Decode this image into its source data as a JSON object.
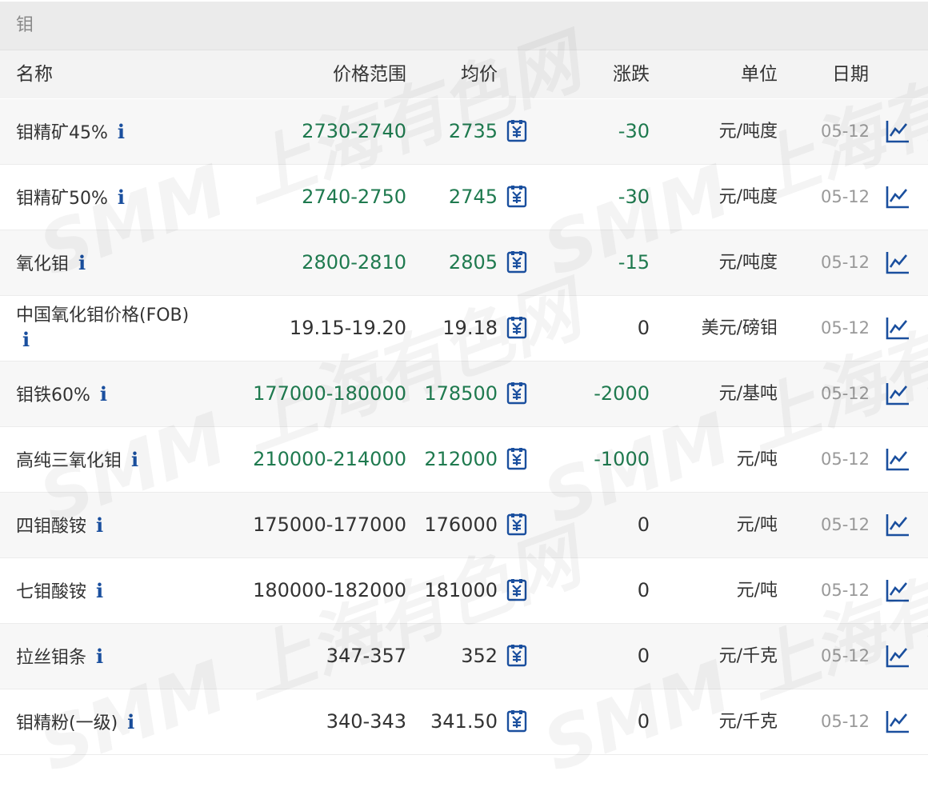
{
  "title": "钼",
  "columns": {
    "name": "名称",
    "range": "价格范围",
    "avg": "均价",
    "change": "涨跌",
    "unit": "单位",
    "date": "日期"
  },
  "info_glyph": "i",
  "watermark": "SMM 上海有色网",
  "colors": {
    "up_green": "#1f7a4f",
    "icon_blue": "#1a4f9e"
  },
  "rows": [
    {
      "name": "钼精矿45%",
      "range": "2730-2740",
      "avg": "2735",
      "change": "-30",
      "unit": "元/吨度",
      "date": "05-12",
      "tone": "green"
    },
    {
      "name": "钼精矿50%",
      "range": "2740-2750",
      "avg": "2745",
      "change": "-30",
      "unit": "元/吨度",
      "date": "05-12",
      "tone": "green"
    },
    {
      "name": "氧化钼",
      "range": "2800-2810",
      "avg": "2805",
      "change": "-15",
      "unit": "元/吨度",
      "date": "05-12",
      "tone": "green"
    },
    {
      "name": "中国氧化钼价格(FOB)",
      "range": "19.15-19.20",
      "avg": "19.18",
      "change": "0",
      "unit": "美元/磅钼",
      "date": "05-12",
      "tone": "dark"
    },
    {
      "name": "钼铁60%",
      "range": "177000-180000",
      "avg": "178500",
      "change": "-2000",
      "unit": "元/基吨",
      "date": "05-12",
      "tone": "green"
    },
    {
      "name": "高纯三氧化钼",
      "range": "210000-214000",
      "avg": "212000",
      "change": "-1000",
      "unit": "元/吨",
      "date": "05-12",
      "tone": "green"
    },
    {
      "name": "四钼酸铵",
      "range": "175000-177000",
      "avg": "176000",
      "change": "0",
      "unit": "元/吨",
      "date": "05-12",
      "tone": "dark"
    },
    {
      "name": "七钼酸铵",
      "range": "180000-182000",
      "avg": "181000",
      "change": "0",
      "unit": "元/吨",
      "date": "05-12",
      "tone": "dark"
    },
    {
      "name": "拉丝钼条",
      "range": "347-357",
      "avg": "352",
      "change": "0",
      "unit": "元/千克",
      "date": "05-12",
      "tone": "dark"
    },
    {
      "name": "钼精粉(一级)",
      "range": "340-343",
      "avg": "341.50",
      "change": "0",
      "unit": "元/千克",
      "date": "05-12",
      "tone": "dark"
    }
  ]
}
